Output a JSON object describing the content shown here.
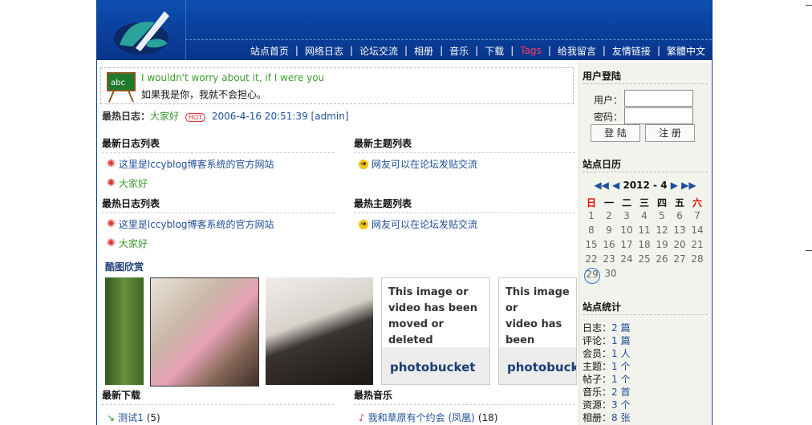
{
  "nav": {
    "items": [
      "站点首页",
      "网络日志",
      "论坛交流",
      "相册",
      "音乐",
      "下载",
      "Tags",
      "给我留言",
      "友情链接",
      "繁體中文"
    ]
  },
  "quote": {
    "en": "I wouldn't worry about it, if I were you",
    "cn": "如果我是你，我就不会担心。"
  },
  "hot_log": {
    "label": "最热日志：",
    "title": "大家好",
    "badge": "HOT",
    "date": "2006-4-16 20:51:39",
    "author": "[admin]"
  },
  "sections": {
    "latest_logs": {
      "title": "最新日志列表",
      "items": [
        "这里是lccyblog博客系统的官方网站",
        "大家好"
      ]
    },
    "latest_topics": {
      "title": "最新主题列表",
      "items": [
        "网友可以在论坛发贴交流"
      ]
    },
    "hot_logs": {
      "title": "最热日志列表",
      "items": [
        "这里是lccyblog博客系统的官方网站",
        "大家好"
      ]
    },
    "hot_topics": {
      "title": "最热主题列表",
      "items": [
        "网友可以在论坛发贴交流"
      ]
    },
    "gallery": {
      "title": "酷图欣赏"
    },
    "downloads": {
      "title": "最新下载",
      "items": [
        {
          "name": "测试1",
          "count": "(5)"
        }
      ]
    },
    "music": {
      "title": "最热音乐",
      "items": [
        {
          "name": "我和草原有个约会 (凤凰)",
          "count": "(18)"
        }
      ]
    }
  },
  "photobucket": {
    "line1": "This image or",
    "line2": "video has been",
    "line3": "moved or deleted",
    "brand": "photobucket"
  },
  "sidebar": {
    "login": {
      "title": "用户登陆",
      "user_label": "用户：",
      "pass_label": "密码：",
      "login_btn": "登 陆",
      "register_btn": "注 册"
    },
    "calendar": {
      "title": "站点日历",
      "year_month": "2012 - 4",
      "weekdays": [
        "日",
        "一",
        "二",
        "三",
        "四",
        "五",
        "六"
      ],
      "weeks": [
        [
          "1",
          "2",
          "3",
          "4",
          "5",
          "6",
          "7"
        ],
        [
          "8",
          "9",
          "10",
          "11",
          "12",
          "13",
          "14"
        ],
        [
          "15",
          "16",
          "17",
          "18",
          "19",
          "20",
          "21"
        ],
        [
          "22",
          "23",
          "24",
          "25",
          "26",
          "27",
          "28"
        ],
        [
          "29",
          "30",
          "",
          "",
          "",
          "",
          ""
        ]
      ]
    },
    "stats": {
      "title": "站点统计",
      "rows": [
        {
          "k": "日志：",
          "v": "2 篇"
        },
        {
          "k": "评论：",
          "v": "1 篇"
        },
        {
          "k": "会员：",
          "v": "1 人"
        },
        {
          "k": "主题：",
          "v": "1 个"
        },
        {
          "k": "帖子：",
          "v": "1 个"
        },
        {
          "k": "音乐：",
          "v": "2 首"
        },
        {
          "k": "资源：",
          "v": "3 个"
        },
        {
          "k": "相册：",
          "v": "8 张"
        }
      ]
    }
  }
}
